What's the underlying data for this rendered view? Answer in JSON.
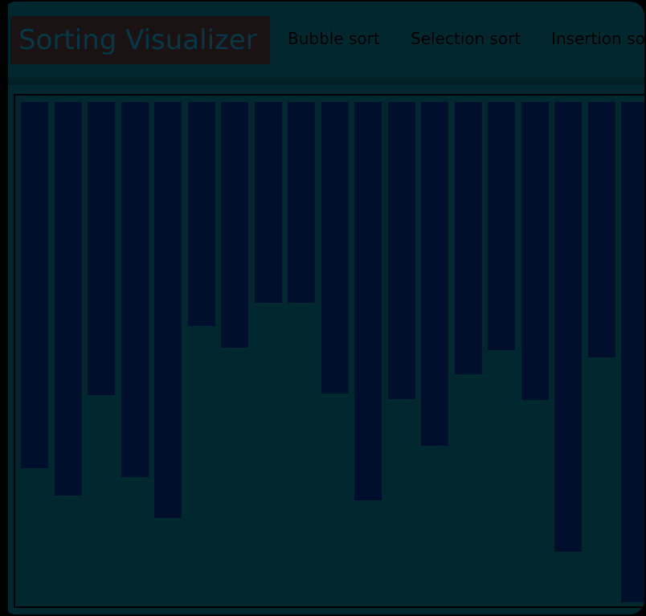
{
  "app": {
    "title": "Sorting Visualizer"
  },
  "nav": {
    "links": [
      {
        "label": "Bubble sort"
      },
      {
        "label": "Selection sort"
      },
      {
        "label": "Insertion so"
      }
    ]
  },
  "colors": {
    "background": "#02282f",
    "bar": "#000f2c",
    "brand_bg": "#1b1214"
  },
  "array": {
    "values": [
      456,
      490,
      365,
      467,
      518,
      279,
      306,
      250,
      250,
      363,
      496,
      370,
      428,
      339,
      309,
      371,
      560,
      318,
      623
    ]
  }
}
